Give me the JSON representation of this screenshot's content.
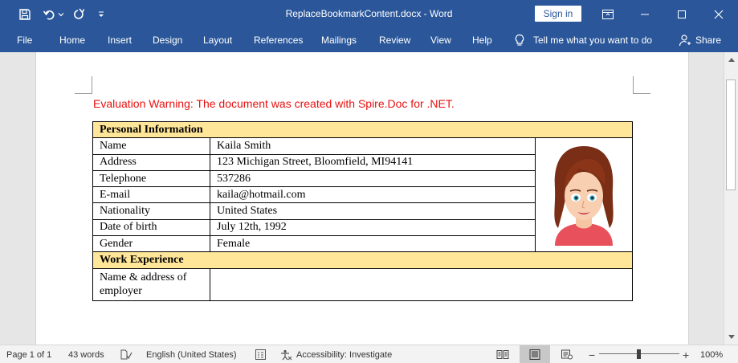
{
  "window": {
    "title": "ReplaceBookmarkContent.docx  -  Word",
    "sign_in": "Sign in"
  },
  "ribbon": {
    "tabs": [
      "File",
      "Home",
      "Insert",
      "Design",
      "Layout",
      "References",
      "Mailings",
      "Review",
      "View",
      "Help"
    ],
    "tell_me": "Tell me what you want to do",
    "share": "Share"
  },
  "document": {
    "warning": "Evaluation Warning: The document was created with Spire.Doc for .NET.",
    "table": {
      "personal_header": "Personal Information",
      "rows": [
        {
          "label": "Name",
          "value": "Kaila Smith"
        },
        {
          "label": "Address",
          "value": "123 Michigan Street, Bloomfield, MI94141"
        },
        {
          "label": "Telephone",
          "value": "537286"
        },
        {
          "label": "E-mail",
          "value": "kaila@hotmail.com"
        },
        {
          "label": "Nationality",
          "value": "United States"
        },
        {
          "label": "Date of birth",
          "value": "July 12th, 1992"
        },
        {
          "label": "Gender",
          "value": "Female"
        }
      ],
      "work_header": "Work Experience",
      "employer_label": "Name & address of employer",
      "employer_value": ""
    }
  },
  "status": {
    "page": "Page 1 of 1",
    "words": "43 words",
    "language": "English (United States)",
    "accessibility": "Accessibility: Investigate",
    "zoom": "100%"
  },
  "colors": {
    "ribbon": "#2b579a",
    "warning": "#e81010",
    "table_header": "#ffe699"
  }
}
